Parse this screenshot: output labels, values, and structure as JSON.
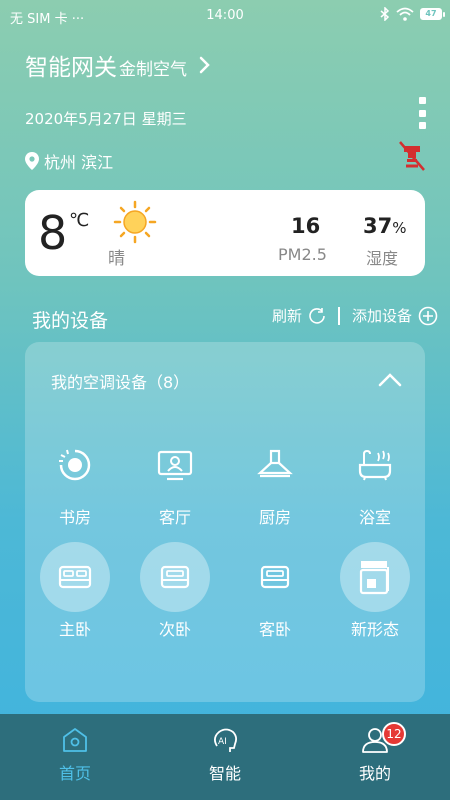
{
  "status_bar": {
    "carrier": "无 SIM 卡 ···",
    "time": "14:00",
    "battery": "47"
  },
  "header": {
    "title": "智能网关",
    "subtitle": "金制空气",
    "date": "2020年5月27日 星期三",
    "location": "杭州 滨江"
  },
  "weather": {
    "temperature": "8",
    "unit": "℃",
    "condition": "晴",
    "pm25_value": "16",
    "pm25_label": "PM2.5",
    "humidity_value": "37",
    "humidity_unit": "%",
    "humidity_label": "湿度"
  },
  "devices": {
    "section_title": "我的设备",
    "refresh_label": "刷新",
    "add_label": "添加设备",
    "group_title": "我的空调设备（8）",
    "rooms": [
      {
        "label": "书房",
        "icon": "study-fan-icon"
      },
      {
        "label": "客厅",
        "icon": "tv-icon"
      },
      {
        "label": "厨房",
        "icon": "range-hood-icon"
      },
      {
        "label": "浴室",
        "icon": "bathtub-icon"
      },
      {
        "label": "主卧",
        "icon": "bed-icon"
      },
      {
        "label": "次卧",
        "icon": "bed-icon"
      },
      {
        "label": "客卧",
        "icon": "bed-icon"
      },
      {
        "label": "新形态",
        "icon": "device-box-icon"
      }
    ]
  },
  "tabs": [
    {
      "label": "首页",
      "icon": "home-icon",
      "active": true
    },
    {
      "label": "智能",
      "icon": "ai-icon",
      "active": false
    },
    {
      "label": "我的",
      "icon": "user-icon",
      "active": false
    }
  ],
  "badge_count": "12",
  "colors": {
    "accent": "#4fc0e8",
    "tabbar": "#2d6e7c",
    "alert": "#e53935"
  }
}
